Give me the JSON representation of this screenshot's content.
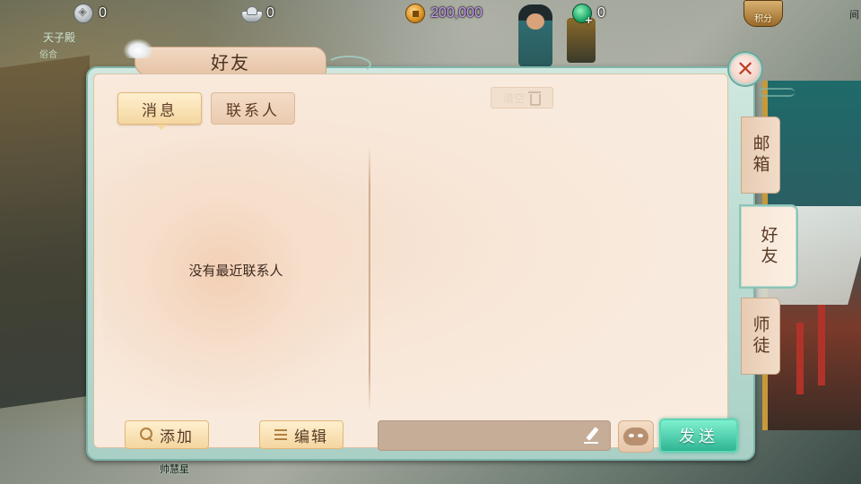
{
  "resources": {
    "silver": "0",
    "ingot": "0",
    "copper": "200,000",
    "jade": "0"
  },
  "points_button": {
    "label": "积分"
  },
  "scene": {
    "bottom_label": "帅慧星",
    "top_left_label": "天子殿",
    "top_left_sub": "俗合",
    "top_right_label": "间"
  },
  "dialog": {
    "title": "好友",
    "close_icon": "✕",
    "subtabs": {
      "messages": "消息",
      "contacts": "联系人"
    },
    "empty_text": "没有最近联系人",
    "clear_label": "清空",
    "add_label": "添加",
    "edit_label": "编辑",
    "input_value": "",
    "send_label": "发送",
    "side_tabs": {
      "mail": "邮箱",
      "friends": "好友",
      "mentor": "师徒"
    }
  }
}
